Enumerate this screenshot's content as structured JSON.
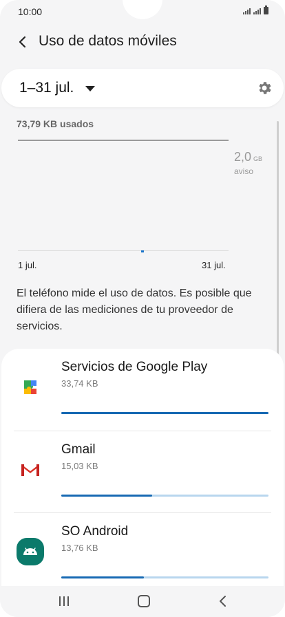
{
  "status_bar": {
    "time": "10:00"
  },
  "header": {
    "title": "Uso de datos móviles"
  },
  "period": {
    "label": "1–31 jul."
  },
  "usage": {
    "used_label": "73,79 KB usados",
    "warning_value": "2,0",
    "warning_unit": "GB",
    "warning_label": "aviso",
    "x_start": "1 jul.",
    "x_end": "31 jul."
  },
  "note": "El teléfono mide el uso de datos. Es posible que difiera de las mediciones de tu proveedor de servicios.",
  "apps": [
    {
      "name": "Servicios de Google Play",
      "size": "33,74 KB",
      "fraction": 1.0
    },
    {
      "name": "Gmail",
      "size": "15,03 KB",
      "fraction": 0.44
    },
    {
      "name": "SO Android",
      "size": "13,76 KB",
      "fraction": 0.4
    }
  ],
  "colors": {
    "accent": "#1769b3",
    "bar_track": "#b8d6ee",
    "android_icon": "#0b7a6b",
    "gmail_red": "#d93025"
  },
  "icons": [
    "back-arrow-icon",
    "caret-down-icon",
    "gear-icon",
    "google-play-services-icon",
    "gmail-icon",
    "android-icon",
    "recent-apps-icon",
    "home-icon",
    "nav-back-icon"
  ]
}
